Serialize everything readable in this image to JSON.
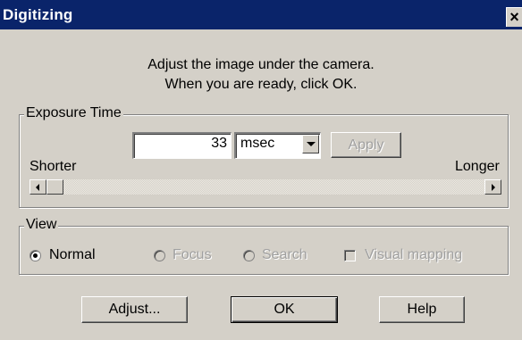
{
  "window": {
    "title": "Digitizing",
    "close_glyph": "×"
  },
  "instructions": {
    "line1": "Adjust the image under the camera.",
    "line2": "When you are ready, click OK."
  },
  "exposure": {
    "group_label": "Exposure Time",
    "value": "33",
    "unit": "msec",
    "apply_label": "Apply",
    "shorter_label": "Shorter",
    "longer_label": "Longer",
    "slider_position": 0.0
  },
  "view": {
    "group_label": "View",
    "options": [
      {
        "label": "Normal",
        "selected": true,
        "enabled": true
      },
      {
        "label": "Focus",
        "selected": false,
        "enabled": false
      },
      {
        "label": "Search",
        "selected": false,
        "enabled": false
      }
    ],
    "visual_mapping_label": "Visual mapping",
    "visual_mapping_checked": false
  },
  "buttons": {
    "adjust": "Adjust...",
    "ok": "OK",
    "help": "Help"
  },
  "colors": {
    "titlebar": "#0a246a",
    "face": "#d4d0c8",
    "disabled_text": "#a0a0a0"
  }
}
